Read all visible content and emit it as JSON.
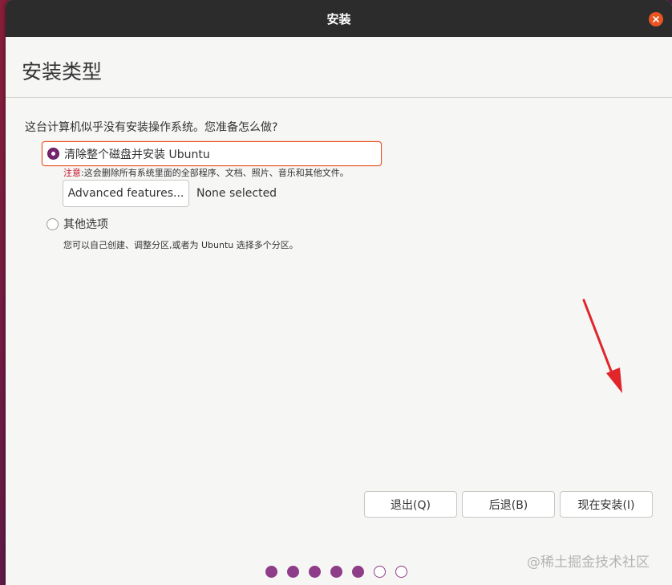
{
  "window": {
    "title": "安装"
  },
  "header": {
    "page_title": "安装类型"
  },
  "main": {
    "question": "这台计算机似乎没有安装操作系统。您准备怎么做?",
    "option_erase": {
      "label": "清除整个磁盘并安装 Ubuntu",
      "selected": true,
      "warning_label": "注意",
      "warning_text": ":这会删除所有系统里面的全部程序、文档、照片、音乐和其他文件。"
    },
    "advanced": {
      "button_label": "Advanced features...",
      "status": "None selected"
    },
    "option_other": {
      "label": "其他选项",
      "selected": false,
      "description": "您可以自己创建、调整分区,或者为 Ubuntu 选择多个分区。"
    }
  },
  "footer": {
    "quit_label": "退出(Q)",
    "back_label": "后退(B)",
    "install_label": "现在安装(I)"
  },
  "progress": {
    "completed_steps": 5,
    "total_steps": 7
  },
  "watermark": "@稀土掘金技术社区",
  "colors": {
    "accent": "#e95420",
    "selected_radio": "#77216f",
    "progress_dot": "#8e3d88",
    "annotation_arrow": "#e0262a"
  },
  "icons": {
    "close": "close-icon"
  }
}
